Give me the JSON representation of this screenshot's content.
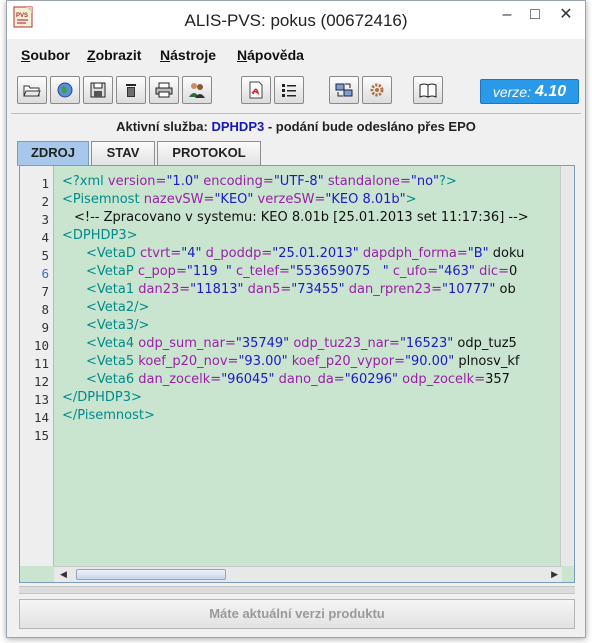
{
  "window": {
    "title": "ALIS-PVS: pokus (00672416)",
    "app_icon_text": "PVS"
  },
  "menu": [
    {
      "mnemonic": "S",
      "rest": "oubor"
    },
    {
      "mnemonic": "Z",
      "rest": "obrazit"
    },
    {
      "mnemonic": "N",
      "rest": "ástroje"
    },
    {
      "mnemonic": "N",
      "rest": "ápověda"
    }
  ],
  "toolbar": {
    "version_label": "verze:",
    "version_number": "4.10"
  },
  "service": {
    "prefix": "Aktivní služba:",
    "code": "DPHDP3",
    "suffix": "- podání bude odesláno přes EPO"
  },
  "tabs": [
    "ZDROJ",
    "STAV",
    "PROTOKOL"
  ],
  "editor": {
    "line_numbers": [
      "1",
      "2",
      "3",
      "4",
      "5",
      "6",
      "7",
      "8",
      "9",
      "10",
      "11",
      "12",
      "13",
      "14",
      "15"
    ],
    "lines": [
      "<?xml version=\"1.0\" encoding=\"UTF-8\" standalone=\"no\"?>",
      "<Pisemnost nazevSW=\"KEO\" verzeSW=\"KEO 8.01b\">",
      "<!-- Zpracovano v systemu: KEO 8.01b [25.01.2013 set 11:17:36] -->",
      "<DPHDP3>",
      "<VetaD ctvrt=\"4\" d_poddp=\"25.01.2013\" dapdph_forma=\"B\" doku",
      "<VetaP c_pop=\"119  \" c_telef=\"553659075   \" c_ufo=\"463\" dic=\"0",
      "<Veta1 dan23=\"11813\" dan5=\"73455\" dan_rpren23=\"10777\" ob",
      "<Veta2/>",
      "<Veta3/>",
      "<Veta4 odp_sum_nar=\"35749\" odp_tuz23_nar=\"16523\" odp_tuz5",
      "<Veta5 koef_p20_nov=\"93.00\" koef_p20_vypor=\"90.00\" plnosv_kf",
      "<Veta6 dan_zocelk=\"96045\" dano_da=\"60296\" odp_zocelk=\"357",
      "</DPHDP3>",
      "</Pisemnost>",
      ""
    ]
  },
  "status_button": "Máte aktuální verzi produktu",
  "colors": {
    "editor_background": "#c9e5cf",
    "tag": "#008b8b",
    "attribute": "#9b1fa8",
    "value": "#1a1acc",
    "version_badge": "#2a9ae8",
    "active_tab": "#a7c8ea"
  },
  "icons": {
    "toolbar": [
      "open-folder-icon",
      "globe-icon",
      "save-icon",
      "delete-icon",
      "print-icon",
      "users-icon",
      "pdf-icon",
      "list-icon",
      "transfer-icon",
      "settings-gear-icon",
      "book-icon"
    ]
  }
}
